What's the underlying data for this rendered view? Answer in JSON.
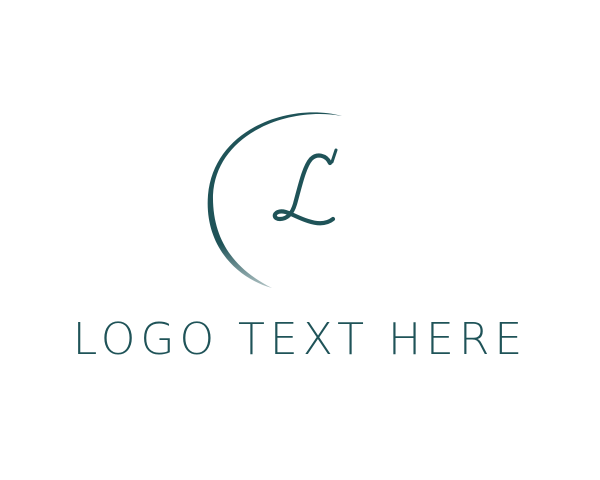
{
  "logo": {
    "monogram": "L",
    "wordmark": "LOGO TEXT HERE",
    "color": "#1f5358",
    "background": "#ffffff",
    "emblem_icon": "crescent-circle-monogram"
  }
}
